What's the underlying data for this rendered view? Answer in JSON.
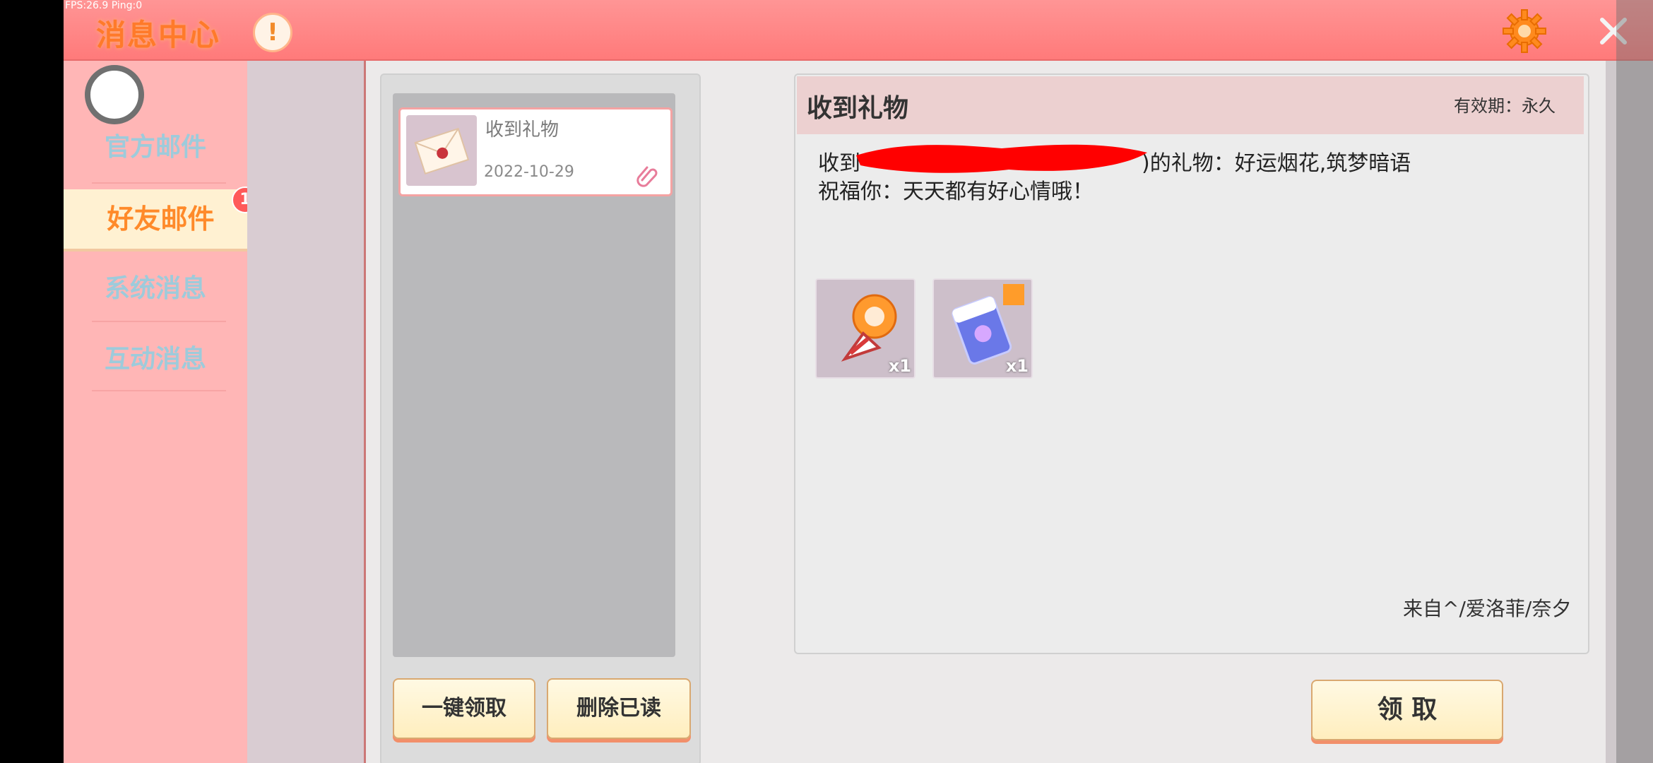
{
  "overlay": {
    "fps_text": "FPS:26.9  Ping:0"
  },
  "header": {
    "title": "消息中心",
    "alert_label": "!"
  },
  "sidebar": {
    "items": [
      {
        "label": "官方邮件"
      },
      {
        "label": "好友邮件",
        "badge": "1"
      },
      {
        "label": "系统消息"
      },
      {
        "label": "互动消息"
      }
    ]
  },
  "mail_list": {
    "items": [
      {
        "title": "收到礼物",
        "date": "2022-10-29"
      }
    ]
  },
  "actions": {
    "claim_all": "一键领取",
    "delete_read": "删除已读",
    "claim": "领 取"
  },
  "detail": {
    "title": "收到礼物",
    "validity": "有效期：永久",
    "line1_prefix": "收到",
    "line1_suffix": ")的礼物：好运烟花,筑梦暗语",
    "line2": "祝福你：天天都有好心情哦！",
    "attachments": [
      {
        "icon": "firework-candy-icon",
        "qty": "x1"
      },
      {
        "icon": "dream-whisper-card-icon",
        "qty": "x1"
      }
    ],
    "sender": "来自^/爱洛菲/奈夕"
  },
  "colors": {
    "header_bg": "#ff8080",
    "title_text": "#ff7a2a",
    "sidebar_bg": "#ffb6b6",
    "active_tab": "#fff1d2",
    "button_bg": "#ffefc3",
    "button_shadow": "#f28f6a"
  }
}
